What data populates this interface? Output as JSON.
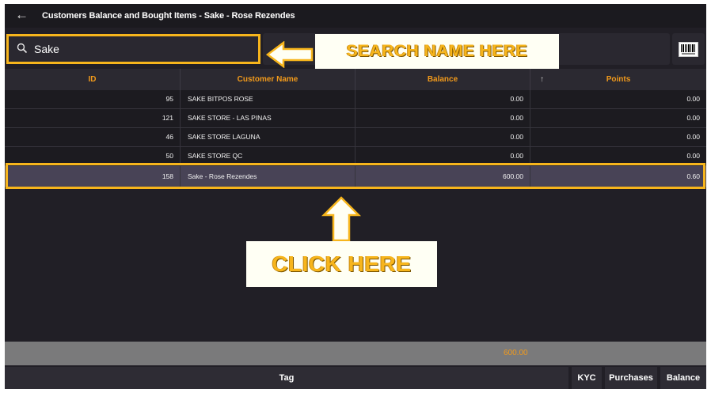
{
  "window": {
    "title": "Customers Balance and Bought Items - Sake - Rose Rezendes"
  },
  "search": {
    "value": "Sake"
  },
  "annotations": {
    "search_hint": "SEARCH NAME HERE",
    "click_hint": "CLICK HERE"
  },
  "table": {
    "headers": [
      "ID",
      "Customer Name",
      "Balance",
      "Points"
    ],
    "sort_indicator": "↑",
    "rows": [
      {
        "id": "95",
        "name": "SAKE BITPOS ROSE",
        "balance": "0.00",
        "points": "0.00"
      },
      {
        "id": "121",
        "name": "SAKE STORE - LAS PINAS",
        "balance": "0.00",
        "points": "0.00"
      },
      {
        "id": "46",
        "name": "SAKE STORE LAGUNA",
        "balance": "0.00",
        "points": "0.00"
      },
      {
        "id": "50",
        "name": "SAKE STORE QC",
        "balance": "0.00",
        "points": "0.00"
      },
      {
        "id": "158",
        "name": "Sake - Rose Rezendes",
        "balance": "600.00",
        "points": "0.60"
      }
    ],
    "selected_row": 4
  },
  "footer": {
    "total_balance": "600.00",
    "tag_label": "Tag",
    "kyc_label": "KYC",
    "purchases_label": "Purchases",
    "balance_label": "Balance"
  },
  "colors": {
    "accent": "#f29a1b",
    "highlight": "#f7b51c",
    "background": "#211f26",
    "selected_row": "#484356"
  },
  "icons": {
    "back": "arrow-left-icon",
    "search": "search-icon",
    "barcode": "barcode-icon",
    "sort": "sort-up-icon"
  }
}
